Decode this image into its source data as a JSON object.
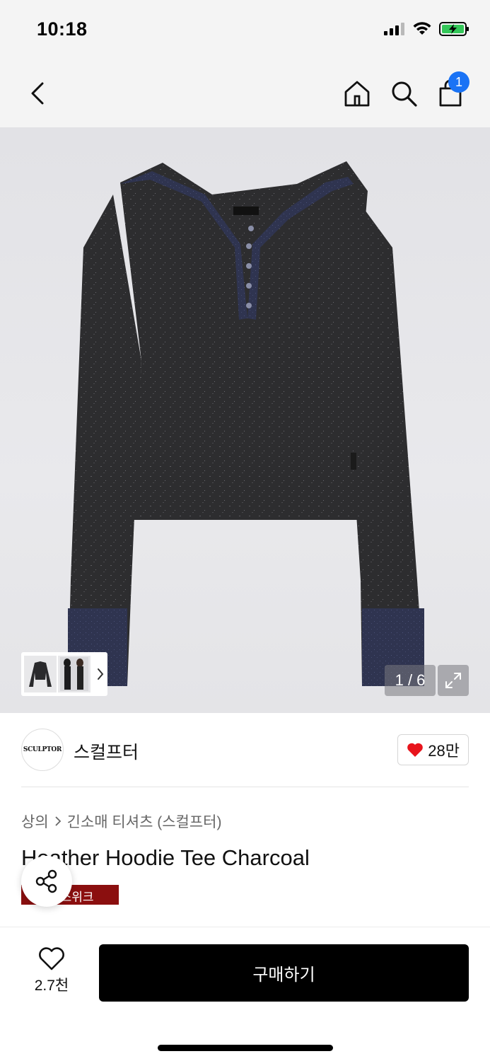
{
  "status": {
    "time": "10:18"
  },
  "nav": {
    "cart_count": "1"
  },
  "gallery": {
    "counter": "1 / 6"
  },
  "brand": {
    "logo_text": "SCULPTOR",
    "name": "스컬프터",
    "likes": "28만"
  },
  "breadcrumb": {
    "category": "상의",
    "subcategory": "긴소매 티셔츠 (스컬프터)"
  },
  "product": {
    "title": "Heather Hoodie Tee Charcoal",
    "tag": "선스위크"
  },
  "actions": {
    "wish_count": "2.7천",
    "buy_label": "구매하기"
  },
  "colors": {
    "accent_badge": "#1a73f5",
    "tag_bg": "#8b0f0f",
    "heart": "#e8141c"
  }
}
